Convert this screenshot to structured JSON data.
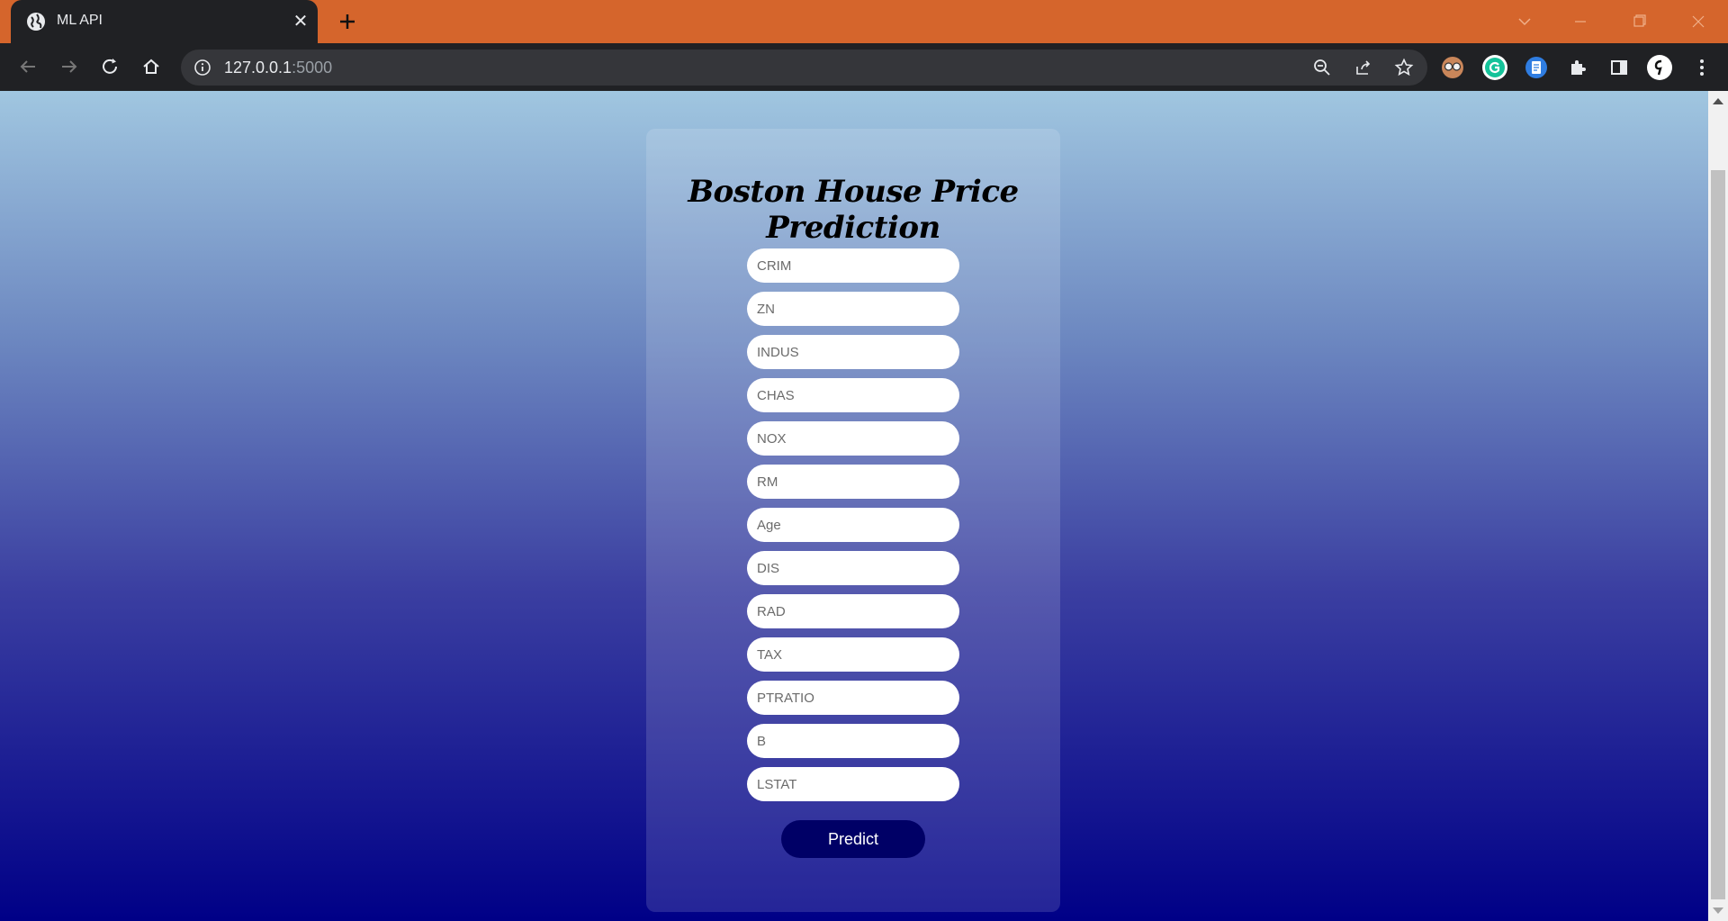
{
  "browser": {
    "tab": {
      "title": "ML API"
    },
    "url": {
      "host": "127.0.0.1",
      "port": ":5000"
    }
  },
  "page": {
    "title": "Boston House Price Prediction",
    "fields": [
      {
        "placeholder": "CRIM"
      },
      {
        "placeholder": "ZN"
      },
      {
        "placeholder": "INDUS"
      },
      {
        "placeholder": "CHAS"
      },
      {
        "placeholder": "NOX"
      },
      {
        "placeholder": "RM"
      },
      {
        "placeholder": "Age"
      },
      {
        "placeholder": "DIS"
      },
      {
        "placeholder": "RAD"
      },
      {
        "placeholder": "TAX"
      },
      {
        "placeholder": "PTRATIO"
      },
      {
        "placeholder": "B"
      },
      {
        "placeholder": "LSTAT"
      }
    ],
    "predict_label": "Predict"
  },
  "colors": {
    "tab_strip": "#d5652c",
    "toolbar": "#202124",
    "gradient_top": "#a0c6e0",
    "gradient_bottom": "#000087",
    "button": "#000066"
  }
}
